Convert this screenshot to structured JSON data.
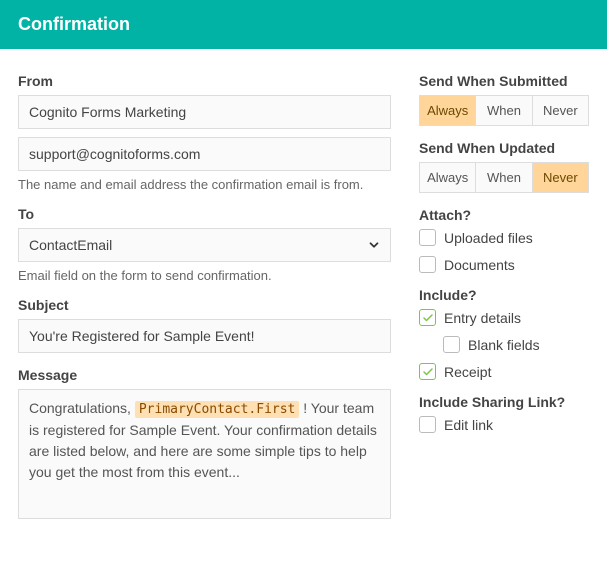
{
  "header": {
    "title": "Confirmation"
  },
  "left": {
    "from": {
      "label": "From",
      "name_value": "Cognito Forms Marketing",
      "email_value": "support@cognitoforms.com",
      "helper": "The name and email address the confirmation email is from."
    },
    "to": {
      "label": "To",
      "value": "ContactEmail",
      "helper": "Email field on the form to send confirmation."
    },
    "subject": {
      "label": "Subject",
      "value": "You're Registered for Sample Event!"
    },
    "message": {
      "label": "Message",
      "pre": "Congratulations, ",
      "token": "PrimaryContact.First",
      "post": " ! Your team is registered for Sample Event. Your confirmation details are listed below, and here are some simple tips to help you get the most from this event..."
    }
  },
  "right": {
    "send_submitted": {
      "label": "Send When Submitted",
      "options": [
        "Always",
        "When",
        "Never"
      ],
      "active_index": 0
    },
    "send_updated": {
      "label": "Send When Updated",
      "options": [
        "Always",
        "When",
        "Never"
      ],
      "active_index": 2
    },
    "attach": {
      "label": "Attach?",
      "items": [
        {
          "label": "Uploaded files",
          "checked": false
        },
        {
          "label": "Documents",
          "checked": false
        }
      ]
    },
    "include": {
      "label": "Include?",
      "items": [
        {
          "label": "Entry details",
          "checked": true,
          "indent": false
        },
        {
          "label": "Blank fields",
          "checked": false,
          "indent": true
        },
        {
          "label": "Receipt",
          "checked": true,
          "indent": false
        }
      ]
    },
    "sharing": {
      "label": "Include Sharing Link?",
      "items": [
        {
          "label": "Edit link",
          "checked": false
        }
      ]
    }
  }
}
